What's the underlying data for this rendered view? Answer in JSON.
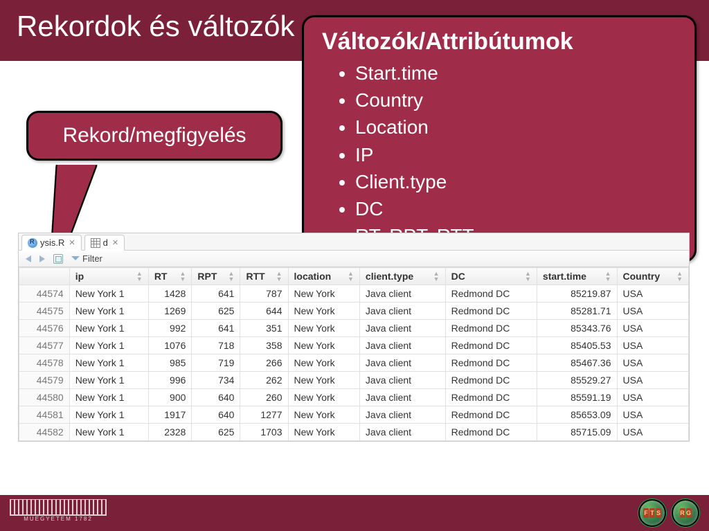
{
  "title": "Rekordok és változók",
  "callout_left": "Rekord/megfigyelés",
  "callout_right": {
    "heading": "Változók/Attribútumok",
    "items": [
      "Start.time",
      "Country",
      "Location",
      "IP",
      "Client.type",
      "DC",
      "RT, RPT, RTT"
    ]
  },
  "tabs": [
    {
      "label": "ysis.R",
      "icon": "r"
    },
    {
      "label": "d",
      "icon": "grid"
    }
  ],
  "toolbar": {
    "filter_label": "Filter"
  },
  "table": {
    "columns": [
      "",
      "ip",
      "RT",
      "RPT",
      "RTT",
      "location",
      "client.type",
      "DC",
      "start.time",
      "Country"
    ],
    "numeric_cols": [
      0,
      2,
      3,
      4,
      8
    ],
    "rows": [
      [
        44574,
        "New York 1",
        1428,
        641,
        787,
        "New York",
        "Java client",
        "Redmond DC",
        85219.87,
        "USA"
      ],
      [
        44575,
        "New York 1",
        1269,
        625,
        644,
        "New York",
        "Java client",
        "Redmond DC",
        85281.71,
        "USA"
      ],
      [
        44576,
        "New York 1",
        992,
        641,
        351,
        "New York",
        "Java client",
        "Redmond DC",
        85343.76,
        "USA"
      ],
      [
        44577,
        "New York 1",
        1076,
        718,
        358,
        "New York",
        "Java client",
        "Redmond DC",
        85405.53,
        "USA"
      ],
      [
        44578,
        "New York 1",
        985,
        719,
        266,
        "New York",
        "Java client",
        "Redmond DC",
        85467.36,
        "USA"
      ],
      [
        44579,
        "New York 1",
        996,
        734,
        262,
        "New York",
        "Java client",
        "Redmond DC",
        85529.27,
        "USA"
      ],
      [
        44580,
        "New York 1",
        900,
        640,
        260,
        "New York",
        "Java client",
        "Redmond DC",
        85591.19,
        "USA"
      ],
      [
        44581,
        "New York 1",
        1917,
        640,
        1277,
        "New York",
        "Java client",
        "Redmond DC",
        85653.09,
        "USA"
      ],
      [
        44582,
        "New York 1",
        2328,
        625,
        1703,
        "New York",
        "Java client",
        "Redmond DC",
        85715.09,
        "USA"
      ]
    ]
  },
  "footer": {
    "logo_text": "MUEGYETEM 1782",
    "badge1": "F T S",
    "badge2": "RG"
  }
}
